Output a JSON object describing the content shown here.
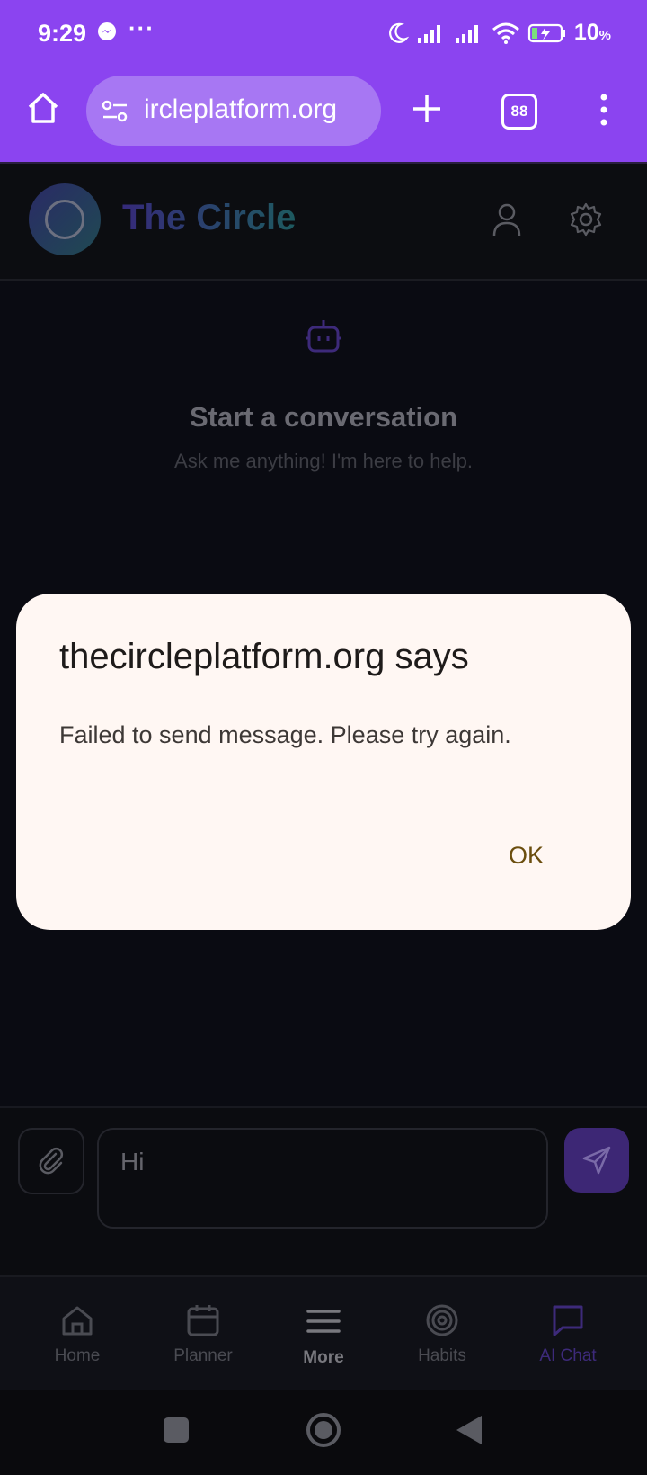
{
  "status_bar": {
    "time": "9:29",
    "dots": "···",
    "battery_value": "10",
    "battery_unit": "%"
  },
  "browser": {
    "url": "ircleplatform.org",
    "tab_count": "88"
  },
  "app": {
    "title": "The Circle"
  },
  "empty_state": {
    "title": "Start a conversation",
    "subtitle": "Ask me anything! I'm here to help."
  },
  "dialog": {
    "title": "thecircleplatform.org says",
    "message": "Failed to send message. Please try again.",
    "ok_label": "OK"
  },
  "composer": {
    "value": "Hi"
  },
  "nav": {
    "items": [
      {
        "label": "Home",
        "icon": "home-icon"
      },
      {
        "label": "Planner",
        "icon": "calendar-icon"
      },
      {
        "label": "More",
        "icon": "menu-icon"
      },
      {
        "label": "Habits",
        "icon": "target-icon"
      },
      {
        "label": "AI Chat",
        "icon": "chat-icon"
      }
    ]
  },
  "colors": {
    "browser_accent": "#8b44f0",
    "dialog_bg": "#fff7f3",
    "ok_text": "#6b4e0e",
    "active_nav": "#3d2a7a"
  }
}
